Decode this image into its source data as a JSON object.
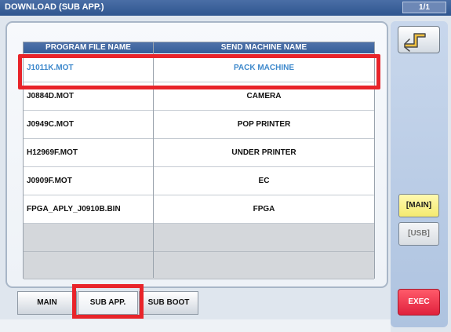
{
  "window": {
    "title": "DOWNLOAD (SUB APP.)",
    "page_indicator": "1/1"
  },
  "table": {
    "headers": [
      "PROGRAM FILE NAME",
      "SEND MACHINE NAME"
    ],
    "rows": [
      {
        "program": "J1011K.MOT",
        "machine": "PACK MACHINE"
      },
      {
        "program": "J0884D.MOT",
        "machine": "CAMERA"
      },
      {
        "program": "J0949C.MOT",
        "machine": "POP PRINTER"
      },
      {
        "program": "H12969F.MOT",
        "machine": "UNDER PRINTER"
      },
      {
        "program": "J0909F.MOT",
        "machine": "EC"
      },
      {
        "program": "FPGA_APLY_J0910B.BIN",
        "machine": "FPGA"
      },
      {
        "program": "",
        "machine": ""
      },
      {
        "program": "",
        "machine": ""
      }
    ]
  },
  "tabs": [
    "MAIN",
    "SUB APP.",
    "SUB BOOT"
  ],
  "side_buttons": {
    "main": "[MAIN]",
    "usb": "[USB]",
    "exec": "EXEC"
  },
  "colors": {
    "selected_text": "#3e89cc",
    "highlight": "#e8242a",
    "exec": "#e0213d",
    "main_button": "#f4ea70"
  }
}
